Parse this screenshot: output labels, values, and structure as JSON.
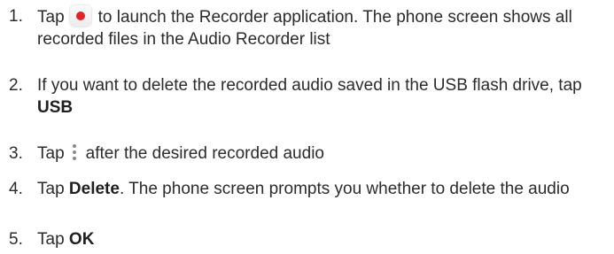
{
  "steps": [
    {
      "number": "1.",
      "before_icon": "Tap",
      "icon": "recorder-app-icon",
      "text": "to launch the Recorder application. The phone screen shows all recorded files in the Audio Recorder list"
    },
    {
      "number": "2.",
      "text": "If you want to delete the recorded audio saved in the USB flash drive, tap",
      "bold": "USB"
    },
    {
      "number": "3.",
      "before_icon": "Tap",
      "icon": "more-vertical-icon",
      "text": "after the desired recorded audio"
    },
    {
      "number": "4.",
      "before_bold": "Tap",
      "bold": "Delete",
      "text": ". The phone screen prompts you whether to delete the audio"
    },
    {
      "number": "5.",
      "before_bold": "Tap",
      "bold": "OK"
    }
  ],
  "colors": {
    "text": "#2b2b2b",
    "record_dot": "#e0242a"
  }
}
